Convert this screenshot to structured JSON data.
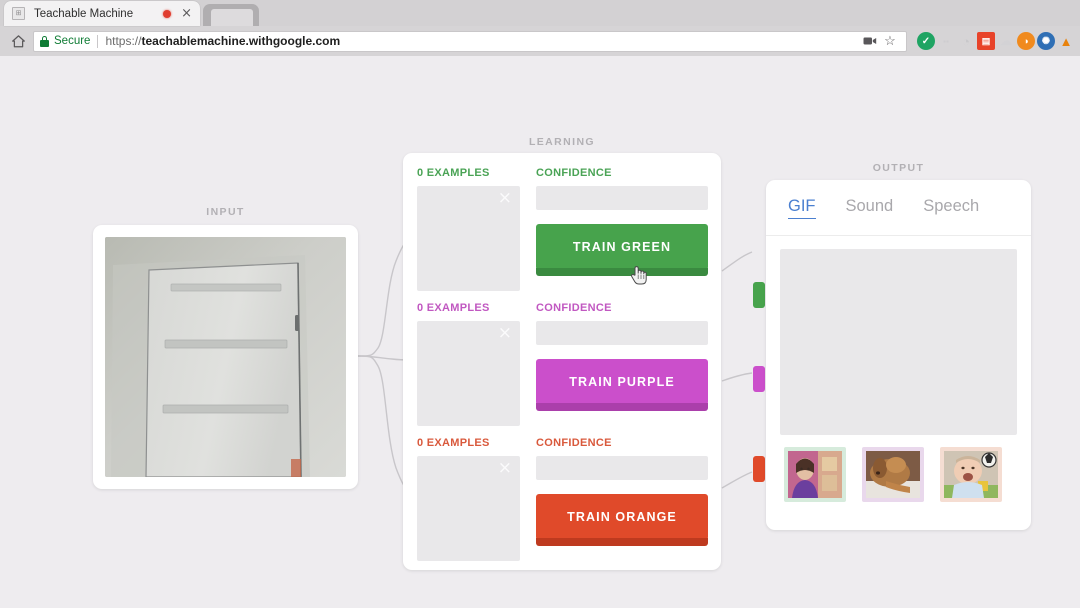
{
  "browser": {
    "tab": {
      "favicon": "page-icon",
      "title": "Teachable Machine",
      "recording_indicator": "record-dot",
      "close": "×"
    },
    "new_tab_ghost": "inactive-tab",
    "toolbar": {
      "home_icon": "home-icon",
      "security_label": "Secure",
      "url_prefix": "https://",
      "url_domain": "teachablemachine.withgoogle.com",
      "camera_icon": "camera-icon",
      "bookmark_icon": "☆",
      "extensions": [
        {
          "name": "extension-green-check",
          "color": "#1fa463",
          "glyph": "✓"
        },
        {
          "name": "extension-faded-text",
          "color": "#d8d6d8",
          "glyph": "•"
        },
        {
          "name": "extension-faded-clock",
          "color": "#dcdade",
          "glyph": "○"
        },
        {
          "name": "extension-red-grid",
          "color": "#e8432a",
          "glyph": "▒"
        },
        {
          "name": "extension-cloud",
          "color": "#dcdade",
          "glyph": "☁"
        },
        {
          "name": "extension-orange-circle",
          "color": "#f08a1e",
          "glyph": "●"
        },
        {
          "name": "extension-globe",
          "color": "#2f6fb5",
          "glyph": "⊕"
        },
        {
          "name": "extension-vlc-cone",
          "color": "#e8820c",
          "glyph": "▲"
        }
      ]
    }
  },
  "page": {
    "input": {
      "label": "INPUT",
      "webcam_subject": "white-panel-door"
    },
    "learning": {
      "label": "LEARNING",
      "classes": [
        {
          "name": "green",
          "examples_label": "0 EXAMPLES",
          "confidence_label": "CONFIDENCE",
          "train_label": "TRAIN GREEN",
          "color": "#47a34c",
          "bevel_color": "#3a8a40",
          "text_color": "#4aa355",
          "confidence_value": 0,
          "examples_count": 0,
          "clear_icon": "×"
        },
        {
          "name": "purple",
          "examples_label": "0 EXAMPLES",
          "confidence_label": "CONFIDENCE",
          "train_label": "TRAIN PURPLE",
          "color": "#cb4fcb",
          "bevel_color": "#ab3fab",
          "text_color": "#c158c1",
          "confidence_value": 0,
          "examples_count": 0,
          "clear_icon": "×"
        },
        {
          "name": "orange",
          "examples_label": "0 EXAMPLES",
          "confidence_label": "CONFIDENCE",
          "train_label": "TRAIN ORANGE",
          "color": "#e04a2a",
          "bevel_color": "#be3a1f",
          "text_color": "#d9593c",
          "confidence_value": 0,
          "examples_count": 0,
          "clear_icon": "×"
        }
      ]
    },
    "output": {
      "label": "OUTPUT",
      "tabs": [
        {
          "label": "GIF",
          "active": true
        },
        {
          "label": "Sound",
          "active": false
        },
        {
          "label": "Speech",
          "active": false
        }
      ],
      "active_tab_color": "#4a7fd0",
      "preview_empty": true,
      "thumbnails": [
        {
          "name": "thumbnail-green-girl",
          "border_color": "#d6ebdc",
          "subject": "girl-in-purple"
        },
        {
          "name": "thumbnail-purple-dog",
          "border_color": "#e9d8ec",
          "subject": "sleeping-dog"
        },
        {
          "name": "thumbnail-orange-baby",
          "border_color": "#f5ddd2",
          "subject": "laughing-baby"
        }
      ]
    },
    "cursor": "pointing-hand-cursor"
  }
}
